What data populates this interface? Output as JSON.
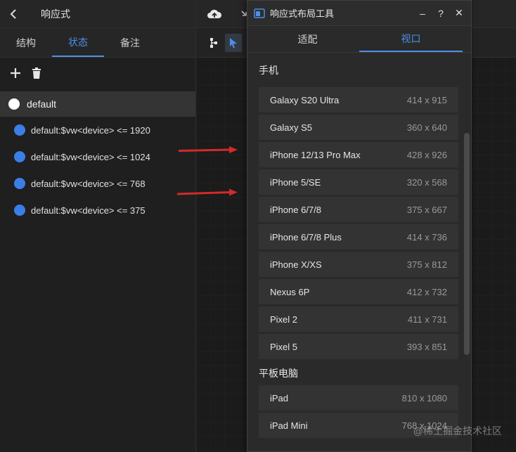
{
  "left_panel": {
    "title": "响应式",
    "tabs": [
      {
        "label": "结构"
      },
      {
        "label": "状态"
      },
      {
        "label": "备注"
      }
    ],
    "default_state": "default",
    "states": [
      {
        "label": "default:$vw<device> <= 1920"
      },
      {
        "label": "default:$vw<device> <= 1024"
      },
      {
        "label": "default:$vw<device> <= 768"
      },
      {
        "label": "default:$vw<device> <= 375"
      }
    ]
  },
  "tool_window": {
    "title": "响应式布局工具",
    "minimize": "–",
    "help": "?",
    "close": "✕",
    "tabs": [
      {
        "label": "适配"
      },
      {
        "label": "视口"
      }
    ],
    "phone_section": "手机",
    "phones": [
      {
        "name": "Galaxy S20 Ultra",
        "size": "414 x 915"
      },
      {
        "name": "Galaxy S5",
        "size": "360 x 640"
      },
      {
        "name": "iPhone 12/13 Pro Max",
        "size": "428 x 926"
      },
      {
        "name": "iPhone 5/SE",
        "size": "320 x 568"
      },
      {
        "name": "iPhone 6/7/8",
        "size": "375 x 667"
      },
      {
        "name": "iPhone 6/7/8 Plus",
        "size": "414 x 736"
      },
      {
        "name": "iPhone X/XS",
        "size": "375 x 812"
      },
      {
        "name": "Nexus 6P",
        "size": "412 x 732"
      },
      {
        "name": "Pixel 2",
        "size": "411 x 731"
      },
      {
        "name": "Pixel 5",
        "size": "393 x 851"
      }
    ],
    "tablet_section": "平板电脑",
    "tablets": [
      {
        "name": "iPad",
        "size": "810 x 1080"
      },
      {
        "name": "iPad Mini",
        "size": "768 x 1024"
      }
    ]
  },
  "watermark": "@稀土掘金技术社区",
  "colors": {
    "accent": "#4d8fe6",
    "state_dot": "#3b7ee8",
    "arrow": "#d42a2a"
  },
  "icons": [
    "back-icon",
    "add-icon",
    "trash-icon",
    "cloud-upload-icon",
    "hierarchy-icon",
    "cursor-icon",
    "window-app-icon"
  ]
}
